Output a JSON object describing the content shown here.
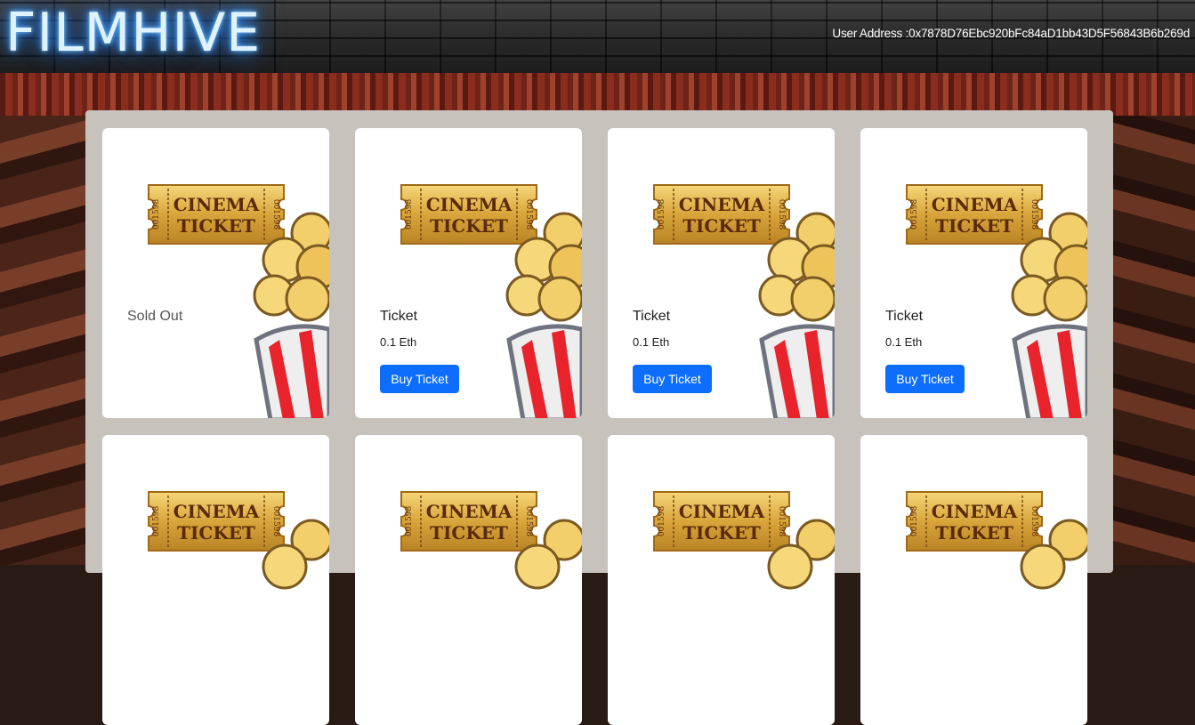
{
  "header": {
    "logo": "FILMHIVE",
    "user_address": "User Address :0x7878D76Ebc920bFc84aD1bb43D5F56843B6b269d"
  },
  "ticket_art": {
    "line1": "CINEMA",
    "line2": "TICKET",
    "serial": "001598"
  },
  "cards": [
    {
      "title": "Sold Out",
      "price": "",
      "button": ""
    },
    {
      "title": "Ticket",
      "price": "0.1 Eth",
      "button": "Buy Ticket"
    },
    {
      "title": "Ticket",
      "price": "0.1 Eth",
      "button": "Buy Ticket"
    },
    {
      "title": "Ticket",
      "price": "0.1 Eth",
      "button": "Buy Ticket"
    }
  ],
  "colors": {
    "button": "#0d6efd",
    "panel": "#c7c2bc",
    "logo_glow": "#3b9cff"
  }
}
